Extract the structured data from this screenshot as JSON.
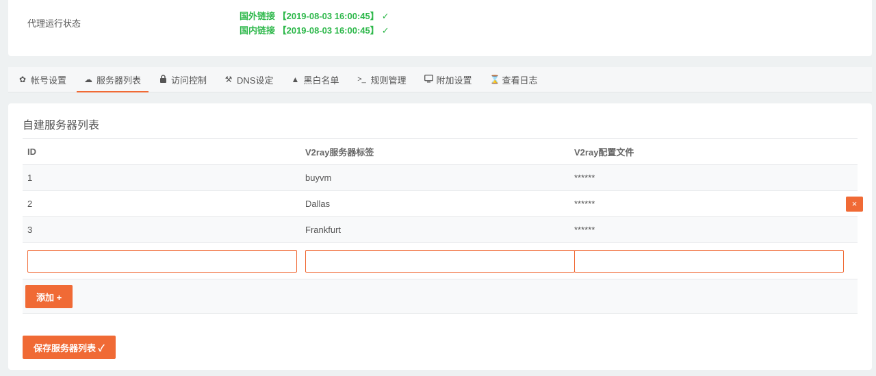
{
  "status": {
    "label": "代理运行状态",
    "lines": [
      {
        "text": "国外链接 【2019-08-03 16:00:45】",
        "mark": "✓"
      },
      {
        "text": "国内链接 【2019-08-03 16:00:45】",
        "mark": "✓"
      }
    ],
    "color": "#2eb84b"
  },
  "tabs": [
    {
      "label": "帐号设置",
      "icon": "gear-icon"
    },
    {
      "label": "服务器列表",
      "icon": "cloud-icon"
    },
    {
      "label": "访问控制",
      "icon": "lock-icon"
    },
    {
      "label": "DNS设定",
      "icon": "tools-icon"
    },
    {
      "label": "黑白名单",
      "icon": "warning-icon"
    },
    {
      "label": "规则管理",
      "icon": "terminal-icon"
    },
    {
      "label": "附加设置",
      "icon": "monitor-icon"
    },
    {
      "label": "查看日志",
      "icon": "hourglass-icon"
    }
  ],
  "active_tab": "服务器列表",
  "server_list": {
    "title": "自建服务器列表",
    "columns": [
      "ID",
      "V2ray服务器标签",
      "V2ray配置文件"
    ],
    "rows": [
      {
        "id": "1",
        "tag": "buyvm",
        "config": "******"
      },
      {
        "id": "2",
        "tag": "Dallas",
        "config": "******"
      },
      {
        "id": "3",
        "tag": "Frankfurt",
        "config": "******"
      }
    ],
    "delete_label": "×",
    "add_label": "添加 +",
    "save_label": "保存服务器列表 ✓"
  },
  "accent_color": "#f06a35"
}
